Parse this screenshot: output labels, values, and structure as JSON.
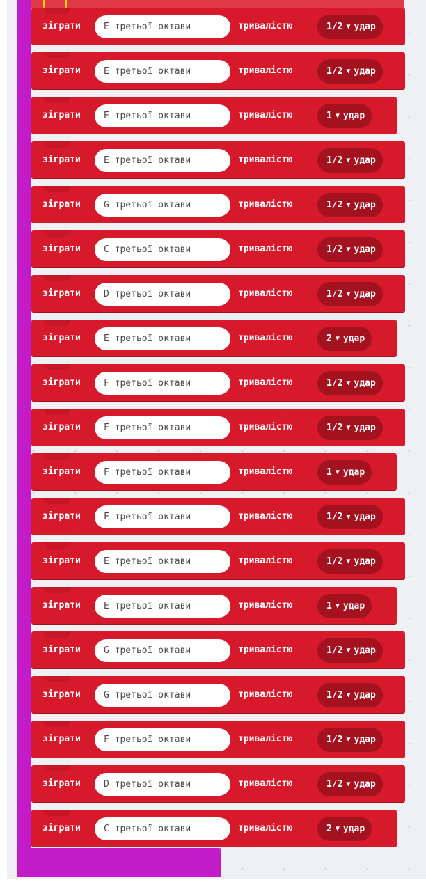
{
  "program": {
    "blocks": [
      {
        "play_label": "зіграти",
        "note": "E третьої октави",
        "duration_label": "тривалістю",
        "beat": "1/2",
        "beat_unit": "удар",
        "dropdown_icon": "caret-down"
      },
      {
        "play_label": "зіграти",
        "note": "E третьої октави",
        "duration_label": "тривалістю",
        "beat": "1/2",
        "beat_unit": "удар",
        "dropdown_icon": "caret-down"
      },
      {
        "play_label": "зіграти",
        "note": "E третьої октави",
        "duration_label": "тривалістю",
        "beat": "1",
        "beat_unit": "удар",
        "dropdown_icon": "caret-down"
      },
      {
        "play_label": "зіграти",
        "note": "E третьої октави",
        "duration_label": "тривалістю",
        "beat": "1/2",
        "beat_unit": "удар",
        "dropdown_icon": "caret-down"
      },
      {
        "play_label": "зіграти",
        "note": "G третьої октави",
        "duration_label": "тривалістю",
        "beat": "1/2",
        "beat_unit": "удар",
        "dropdown_icon": "caret-down"
      },
      {
        "play_label": "зіграти",
        "note": "C третьої октави",
        "duration_label": "тривалістю",
        "beat": "1/2",
        "beat_unit": "удар",
        "dropdown_icon": "caret-down"
      },
      {
        "play_label": "зіграти",
        "note": "D третьої октави",
        "duration_label": "тривалістю",
        "beat": "1/2",
        "beat_unit": "удар",
        "dropdown_icon": "caret-down"
      },
      {
        "play_label": "зіграти",
        "note": "E третьої октави",
        "duration_label": "тривалістю",
        "beat": "2",
        "beat_unit": "удар",
        "dropdown_icon": "caret-down"
      },
      {
        "play_label": "зіграти",
        "note": "F третьої октави",
        "duration_label": "тривалістю",
        "beat": "1/2",
        "beat_unit": "удар",
        "dropdown_icon": "caret-down"
      },
      {
        "play_label": "зіграти",
        "note": "F третьої октави",
        "duration_label": "тривалістю",
        "beat": "1/2",
        "beat_unit": "удар",
        "dropdown_icon": "caret-down"
      },
      {
        "play_label": "зіграти",
        "note": "F третьої октави",
        "duration_label": "тривалістю",
        "beat": "1",
        "beat_unit": "удар",
        "dropdown_icon": "caret-down"
      },
      {
        "play_label": "зіграти",
        "note": "F третьої октави",
        "duration_label": "тривалістю",
        "beat": "1/2",
        "beat_unit": "удар",
        "dropdown_icon": "caret-down"
      },
      {
        "play_label": "зіграти",
        "note": "E третьої октави",
        "duration_label": "тривалістю",
        "beat": "1/2",
        "beat_unit": "удар",
        "dropdown_icon": "caret-down"
      },
      {
        "play_label": "зіграти",
        "note": "E третьої октави",
        "duration_label": "тривалістю",
        "beat": "1",
        "beat_unit": "удар",
        "dropdown_icon": "caret-down"
      },
      {
        "play_label": "зіграти",
        "note": "G третьої октави",
        "duration_label": "тривалістю",
        "beat": "1/2",
        "beat_unit": "удар",
        "dropdown_icon": "caret-down"
      },
      {
        "play_label": "зіграти",
        "note": "G третьої октави",
        "duration_label": "тривалістю",
        "beat": "1/2",
        "beat_unit": "удар",
        "dropdown_icon": "caret-down"
      },
      {
        "play_label": "зіграти",
        "note": "F третьої октави",
        "duration_label": "тривалістю",
        "beat": "1/2",
        "beat_unit": "удар",
        "dropdown_icon": "caret-down"
      },
      {
        "play_label": "зіграти",
        "note": "D третьої октави",
        "duration_label": "тривалістю",
        "beat": "1/2",
        "beat_unit": "удар",
        "dropdown_icon": "caret-down"
      },
      {
        "play_label": "зіграти",
        "note": "C третьої октави",
        "duration_label": "тривалістю",
        "beat": "2",
        "beat_unit": "удар",
        "dropdown_icon": "caret-down"
      }
    ]
  },
  "colors": {
    "music_block": "#d61a2c",
    "music_block_dark": "#a4121f",
    "container_block": "#c41bc8",
    "selection_highlight": "#f5d30f",
    "workspace": "#eef0f3"
  }
}
